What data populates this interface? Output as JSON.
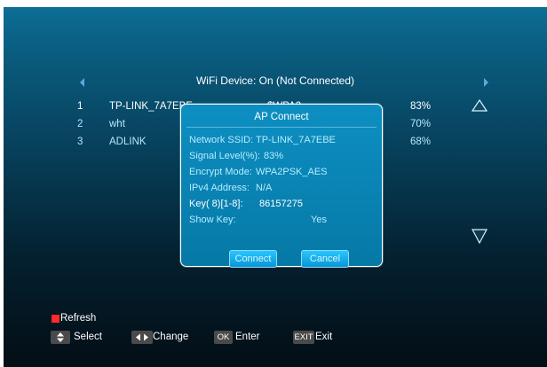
{
  "header": {
    "title": "WiFi Device: On (Not Connected)"
  },
  "networks": [
    {
      "num": "1",
      "ssid": "TP-LINK_7A7EBE",
      "encrypt": "$WPA2",
      "signal": "83%"
    },
    {
      "num": "2",
      "ssid": "wht",
      "encrypt": "",
      "signal": "70%"
    },
    {
      "num": "3",
      "ssid": "ADLINK",
      "encrypt": "",
      "signal": "68%"
    }
  ],
  "dialog": {
    "title": "AP Connect",
    "fields": [
      {
        "label": "Network SSID:",
        "value": "TP-LINK_7A7EBE"
      },
      {
        "label": "Signal Level(%):",
        "value": "83%"
      },
      {
        "label": "Encrypt Mode:",
        "value": "WPA2PSK_AES"
      },
      {
        "label": "IPv4 Address:",
        "value": "N/A"
      },
      {
        "label": "Key( 8)[1-8]:",
        "value": "86157275"
      },
      {
        "label": "Show Key:",
        "value": "Yes"
      }
    ],
    "connect_label": "Connect",
    "cancel_label": "Cancel"
  },
  "footer": {
    "refresh_label": "Refresh",
    "select_label": "Select",
    "change_label": "Change",
    "enter_key": "OK",
    "enter_label": "Enter",
    "exit_key": "EXIT",
    "exit_label": "Exit"
  },
  "colors": {
    "refresh_key": "#ff2a2a",
    "dialog_bg": "#0a86b8",
    "highlight_text": "#b8e6ff"
  },
  "icons": {
    "page_left": "triangle-left-icon",
    "page_right": "triangle-right-icon",
    "scroll_up": "triangle-up-outline-icon",
    "scroll_down": "triangle-down-outline-icon",
    "select_key": "up-down-arrows-icon",
    "change_key": "left-right-arrows-icon"
  }
}
